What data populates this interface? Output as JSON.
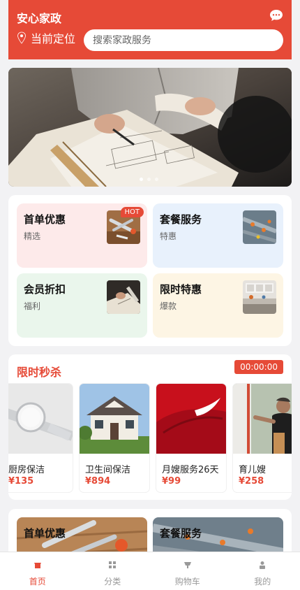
{
  "app": {
    "title": "安心家政"
  },
  "header": {
    "location_label": "当前定位"
  },
  "search": {
    "placeholder": "搜索家政服务"
  },
  "colors": {
    "brand": "#e64a37",
    "pink": "#fdeaea",
    "blue": "#e8f1fc",
    "green": "#eaf6ec",
    "yellow": "#fdf5e4"
  },
  "banner": {
    "slide_count": 3,
    "active_index": 0
  },
  "promos": [
    {
      "title": "首单优惠",
      "sub": "精选",
      "badge": "HOT"
    },
    {
      "title": "套餐服务",
      "sub": "特惠",
      "badge": ""
    },
    {
      "title": "会员折扣",
      "sub": "福利",
      "badge": ""
    },
    {
      "title": "限时特惠",
      "sub": "爆款",
      "badge": ""
    }
  ],
  "flash_sale": {
    "title": "限时秒杀",
    "timer": "00:00:00",
    "items": [
      {
        "name": "厨房保洁",
        "price": "¥135"
      },
      {
        "name": "卫生间保洁",
        "price": "¥894"
      },
      {
        "name": "月嫂服务26天",
        "price": "¥99"
      },
      {
        "name": "育儿嫂",
        "price": "¥258"
      }
    ]
  },
  "featured": [
    {
      "title": "首单优惠"
    },
    {
      "title": "套餐服务"
    }
  ],
  "tabbar": [
    {
      "label": "首页",
      "icon": "home-icon",
      "active": true
    },
    {
      "label": "分类",
      "icon": "category-icon",
      "active": false
    },
    {
      "label": "购物车",
      "icon": "cart-icon",
      "active": false
    },
    {
      "label": "我的",
      "icon": "profile-icon",
      "active": false
    }
  ]
}
